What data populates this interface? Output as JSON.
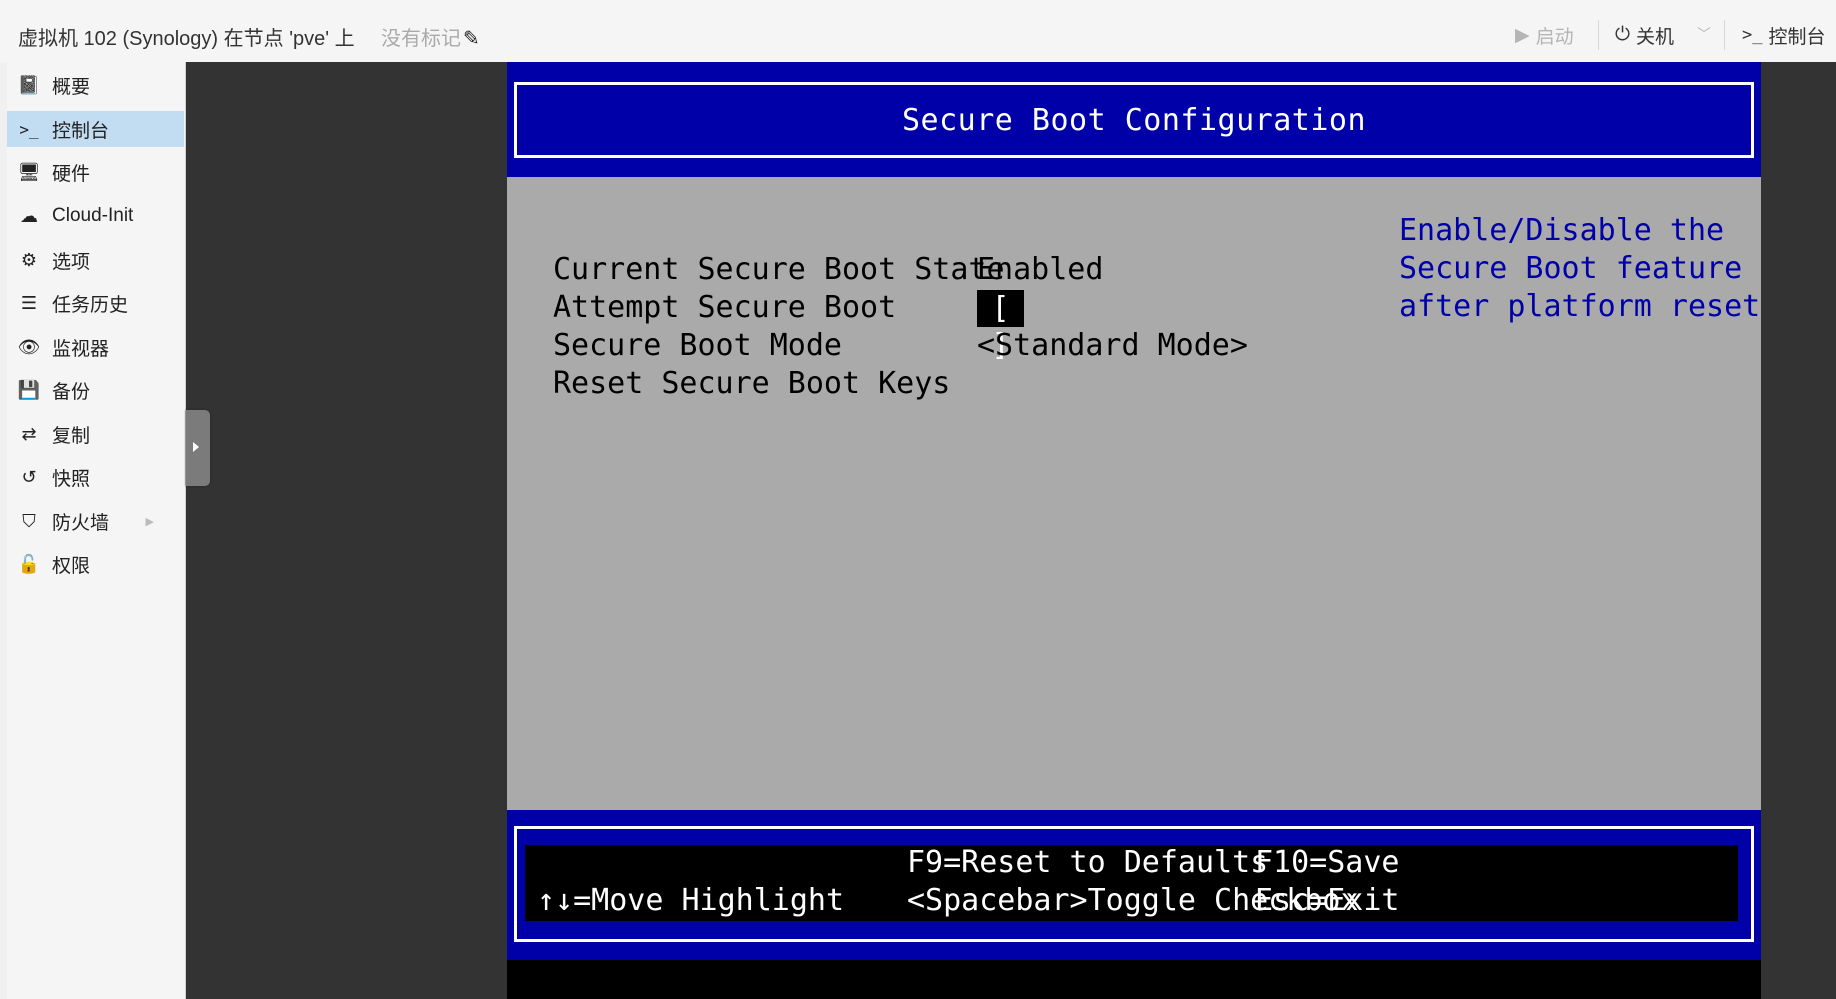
{
  "header": {
    "vm_title": "虚拟机 102 (Synology) 在节点 'pve' 上",
    "tags_label": "没有标记",
    "start_label": "启动",
    "shutdown_label": "关机",
    "console_label": "控制台"
  },
  "sidebar": {
    "items": [
      {
        "label": "概要",
        "icon": "book-icon"
      },
      {
        "label": "控制台",
        "icon": "terminal-icon"
      },
      {
        "label": "硬件",
        "icon": "monitor-icon"
      },
      {
        "label": "Cloud-Init",
        "icon": "cloud-icon"
      },
      {
        "label": "选项",
        "icon": "gear-icon"
      },
      {
        "label": "任务历史",
        "icon": "list-icon"
      },
      {
        "label": "监视器",
        "icon": "eye-icon"
      },
      {
        "label": "备份",
        "icon": "floppy-icon"
      },
      {
        "label": "复制",
        "icon": "retweet-icon"
      },
      {
        "label": "快照",
        "icon": "history-icon"
      },
      {
        "label": "防火墙",
        "icon": "shield-icon"
      },
      {
        "label": "权限",
        "icon": "unlock-icon"
      }
    ],
    "active_index": 1
  },
  "bios": {
    "title": "Secure Boot Configuration",
    "rows": [
      {
        "label": "Current Secure Boot State",
        "value": "Enabled"
      },
      {
        "label": "Attempt Secure Boot",
        "value": "[ ]"
      },
      {
        "label": "Secure Boot Mode",
        "value": "<Standard Mode>"
      },
      {
        "label": "Reset Secure Boot Keys",
        "value": ""
      }
    ],
    "help": "Enable/Disable the\nSecure Boot feature\nafter platform reset",
    "footer": {
      "f9": "F9=Reset to Defaults",
      "f10": "F10=Save",
      "move": "↑↓=Move Highlight",
      "toggle": "<Spacebar>Toggle Checkbox",
      "esc": "Esc=Exit"
    }
  },
  "colors": {
    "bios_blue": "#0000a8",
    "bios_gray": "#aaaaaa",
    "active_nav": "#c2ddf2",
    "console_bg": "#333333"
  }
}
